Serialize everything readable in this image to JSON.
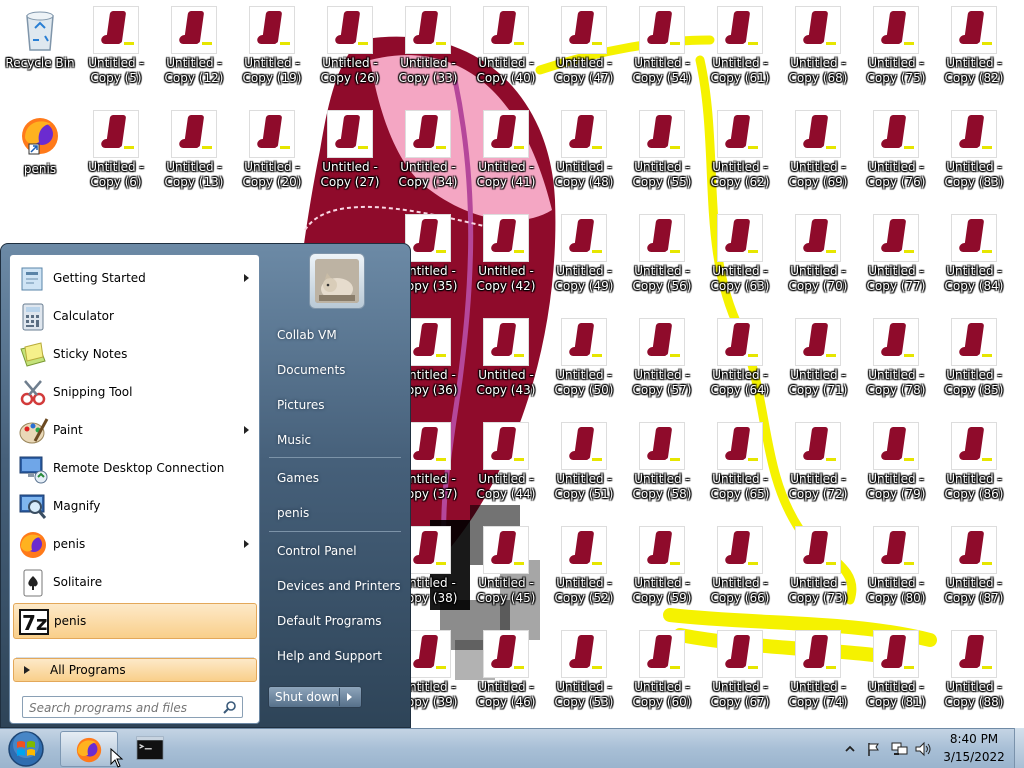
{
  "desktop": {
    "system_icons": [
      {
        "label": "Recycle Bin",
        "icon": "recycle-bin-icon"
      },
      {
        "label": "penis",
        "icon": "firefox-icon"
      }
    ],
    "untitled_copies": [
      {
        "label": "Untitled - Copy (5)"
      },
      {
        "label": "Untitled - Copy (6)"
      },
      {
        "label": "Untitled - Copy (12)"
      },
      {
        "label": "Untitled - Copy (13)"
      },
      {
        "label": "Untitled - Copy (19)"
      },
      {
        "label": "Untitled - Copy (20)"
      },
      {
        "label": "Untitled - Copy (26)"
      },
      {
        "label": "Untitled - Copy (27)"
      },
      {
        "label": "Untitled - Copy (33)"
      },
      {
        "label": "Untitled - Copy (34)"
      },
      {
        "label": "Untitled - Copy (35)"
      },
      {
        "label": "Untitled - Copy (36)"
      },
      {
        "label": "Untitled - Copy (37)"
      },
      {
        "label": "Untitled - Copy (38)"
      },
      {
        "label": "Untitled - Copy (39)"
      },
      {
        "label": "Untitled - Copy (40)"
      },
      {
        "label": "Untitled - Copy (41)"
      },
      {
        "label": "Untitled - Copy (42)"
      },
      {
        "label": "Untitled - Copy (43)"
      },
      {
        "label": "Untitled - Copy (44)"
      },
      {
        "label": "Untitled - Copy (45)"
      },
      {
        "label": "Untitled - Copy (46)"
      },
      {
        "label": "Untitled - Copy (47)"
      },
      {
        "label": "Untitled - Copy (48)"
      },
      {
        "label": "Untitled - Copy (49)"
      },
      {
        "label": "Untitled - Copy (50)"
      },
      {
        "label": "Untitled - Copy (51)"
      },
      {
        "label": "Untitled - Copy (52)"
      },
      {
        "label": "Untitled - Copy (53)"
      },
      {
        "label": "Untitled - Copy (54)"
      },
      {
        "label": "Untitled - Copy (55)"
      },
      {
        "label": "Untitled - Copy (56)"
      },
      {
        "label": "Untitled - Copy (57)"
      },
      {
        "label": "Untitled - Copy (58)"
      },
      {
        "label": "Untitled - Copy (59)"
      },
      {
        "label": "Untitled - Copy (60)"
      },
      {
        "label": "Untitled - Copy (61)"
      },
      {
        "label": "Untitled - Copy (62)"
      },
      {
        "label": "Untitled - Copy (63)"
      },
      {
        "label": "Untitled - Copy (64)"
      },
      {
        "label": "Untitled - Copy (65)"
      },
      {
        "label": "Untitled - Copy (66)"
      },
      {
        "label": "Untitled - Copy (67)"
      },
      {
        "label": "Untitled - Copy (68)"
      },
      {
        "label": "Untitled - Copy (69)"
      },
      {
        "label": "Untitled - Copy (70)"
      },
      {
        "label": "Untitled - Copy (71)"
      },
      {
        "label": "Untitled - Copy (72)"
      },
      {
        "label": "Untitled - Copy (73)"
      },
      {
        "label": "Untitled - Copy (74)"
      },
      {
        "label": "Untitled - Copy (75)"
      },
      {
        "label": "Untitled - Copy (76)"
      },
      {
        "label": "Untitled - Copy (77)"
      },
      {
        "label": "Untitled - Copy (78)"
      },
      {
        "label": "Untitled - Copy (79)"
      },
      {
        "label": "Untitled - Copy (80)"
      },
      {
        "label": "Untitled - Copy (81)"
      },
      {
        "label": "Untitled - Copy (82)"
      },
      {
        "label": "Untitled - Copy (83)"
      },
      {
        "label": "Untitled - Copy (84)"
      },
      {
        "label": "Untitled - Copy (85)"
      },
      {
        "label": "Untitled - Copy (86)"
      },
      {
        "label": "Untitled - Copy (87)"
      },
      {
        "label": "Untitled - Copy (88)"
      }
    ]
  },
  "start_menu": {
    "programs": [
      {
        "label": "Getting Started",
        "icon": "getting-started-icon",
        "submenu": true
      },
      {
        "label": "Calculator",
        "icon": "calculator-icon",
        "submenu": false
      },
      {
        "label": "Sticky Notes",
        "icon": "sticky-notes-icon",
        "submenu": false
      },
      {
        "label": "Snipping Tool",
        "icon": "snipping-tool-icon",
        "submenu": false
      },
      {
        "label": "Paint",
        "icon": "paint-icon",
        "submenu": true
      },
      {
        "label": "Remote Desktop Connection",
        "icon": "remote-desktop-icon",
        "submenu": false
      },
      {
        "label": "Magnify",
        "icon": "magnify-icon",
        "submenu": false
      },
      {
        "label": "penis",
        "icon": "firefox-icon",
        "submenu": true
      },
      {
        "label": "Solitaire",
        "icon": "solitaire-icon",
        "submenu": false
      },
      {
        "label": "penis",
        "icon": "7zip-icon",
        "submenu": false,
        "highlighted": true
      }
    ],
    "all_programs": "All Programs",
    "search_placeholder": "Search programs and files",
    "right_links": [
      {
        "label": "Collab VM"
      },
      {
        "label": "Documents"
      },
      {
        "label": "Pictures"
      },
      {
        "label": "Music"
      },
      {
        "label": "Games"
      },
      {
        "label": "penis"
      },
      {
        "label": "Control Panel"
      },
      {
        "label": "Devices and Printers"
      },
      {
        "label": "Default Programs"
      },
      {
        "label": "Help and Support"
      }
    ],
    "shutdown_label": "Shut down"
  },
  "taskbar": {
    "pinned": [
      {
        "name": "firefox-icon",
        "active": true
      },
      {
        "name": "command-prompt-icon",
        "active": false
      }
    ],
    "clock_time": "8:40 PM",
    "clock_date": "3/15/2022"
  },
  "colors": {
    "boot_red": "#8f0b2b",
    "pink": "#f4a6c3",
    "yellow": "#f5f200",
    "menu_blue": "#46607a",
    "taskbar": "#a8bfd6"
  }
}
